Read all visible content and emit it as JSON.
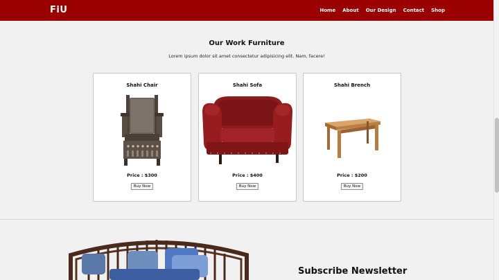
{
  "nav": {
    "logo": "FiU",
    "links": [
      "Home",
      "About",
      "Our Design",
      "Contact",
      "Shop"
    ]
  },
  "section": {
    "title": "Our Work Furniture",
    "subtitle": "Lorem ipsum dolor sit amet consectetur adipisicing elit. Nam, facere!"
  },
  "products": [
    {
      "name": "Shahi Chair",
      "price": "Price : $300",
      "button": "Buy Now",
      "image_icon": "armchair-image"
    },
    {
      "name": "Shahi Sofa",
      "price": "Price : $400",
      "button": "Buy Now",
      "image_icon": "sofa-image"
    },
    {
      "name": "Shahi Brench",
      "price": "Price : $200",
      "button": "Buy Now",
      "image_icon": "table-image"
    }
  ],
  "newsletter": {
    "title": "Subscribe Newsletter"
  },
  "colors": {
    "navbar": "#9b0000",
    "background": "#f1f1f1",
    "card": "#ffffff"
  }
}
